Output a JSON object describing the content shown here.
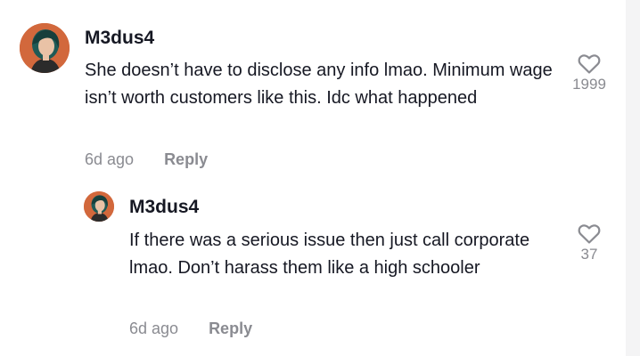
{
  "comments": [
    {
      "username": "M3dus4",
      "text": "She doesn’t have to disclose any info lmao. Minimum wage isn’t worth customers like this. Idc what happened",
      "time": "6d ago",
      "reply_label": "Reply",
      "likes": "1999",
      "avatar_icon": "user-avatar-icon",
      "like_icon": "heart-outline-icon"
    },
    {
      "username": "M3dus4",
      "text": "If there was a serious issue then just call corporate lmao. Don’t harass them like a high schooler",
      "time": "6d ago",
      "reply_label": "Reply",
      "likes": "37",
      "avatar_icon": "user-avatar-icon",
      "like_icon": "heart-outline-icon"
    }
  ]
}
